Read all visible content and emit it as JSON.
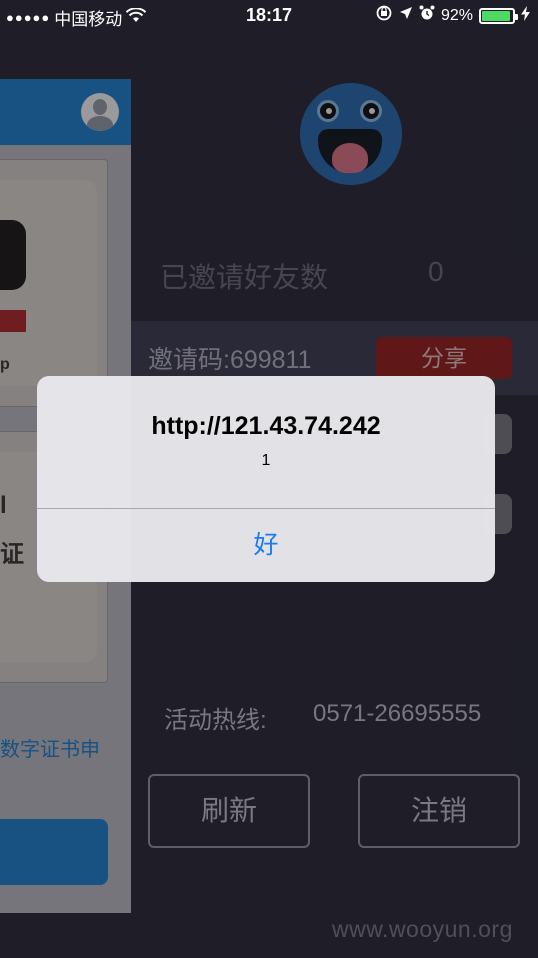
{
  "status_bar": {
    "signal": "●●●●●",
    "carrier": "中国移动",
    "wifi_icon": "wifi-icon",
    "time": "18:17",
    "rotation_lock_icon": "rotation-lock-icon",
    "location_icon": "location-arrow-icon",
    "alarm_icon": "alarm-icon",
    "battery_percent": "92%",
    "battery_level": 0.92,
    "charging_icon": "charging-bolt-icon"
  },
  "side_panel": {
    "header_color": "#1e86d4",
    "profile_icon": "user-profile-icon",
    "card_a_char": "p",
    "card_b_chars": [
      "l",
      "证"
    ],
    "cert_link": "数字证书申"
  },
  "main": {
    "invited_label": "已邀请好友数",
    "invited_count": "0",
    "invite_code": "邀请码:699811",
    "share_label": "分享",
    "hotline_label": "活动热线:",
    "hotline_number": "0571-26695555",
    "refresh_label": "刷新",
    "logout_label": "注销"
  },
  "alert": {
    "title": "http://121.43.74.242",
    "message": "1",
    "ok_label": "好",
    "ok_color": "#1a7cf0"
  },
  "watermark": "www.wooyun.org"
}
